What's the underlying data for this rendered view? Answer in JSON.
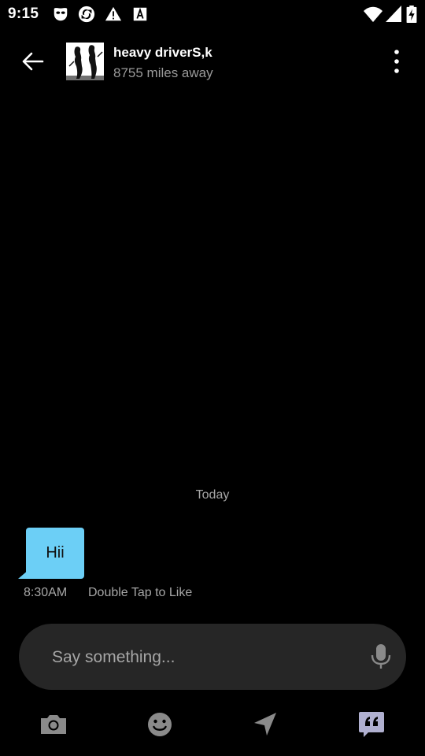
{
  "status_bar": {
    "time": "9:15",
    "icons": [
      "grindr-mask-icon",
      "vpn-sync-icon",
      "warning-icon",
      "font-a-icon"
    ],
    "right_icons": [
      "wifi-icon",
      "cell-signal-icon",
      "battery-charging-icon"
    ]
  },
  "header": {
    "back_icon": "arrow-left-icon",
    "contact_name": "heavy driverS,k",
    "distance": "8755 miles away",
    "more_icon": "more-vertical-icon"
  },
  "conversation": {
    "date_divider": "Today",
    "messages": [
      {
        "text": "Hii",
        "time": "8:30AM",
        "hint": "Double Tap to Like",
        "bubble_color": "#6ccff6"
      }
    ]
  },
  "composer": {
    "placeholder": "Say something...",
    "value": "",
    "mic_icon": "microphone-icon"
  },
  "toolbar": {
    "items": [
      "camera-icon",
      "emoji-icon",
      "send-location-icon",
      "saved-phrases-icon"
    ]
  },
  "colors": {
    "background": "#000000",
    "bubble": "#6ccff6",
    "composer": "#262626",
    "muted_text": "#a6a6a6",
    "icon_gray": "#8a8a8a",
    "phrases_accent": "#b0b0d0"
  }
}
